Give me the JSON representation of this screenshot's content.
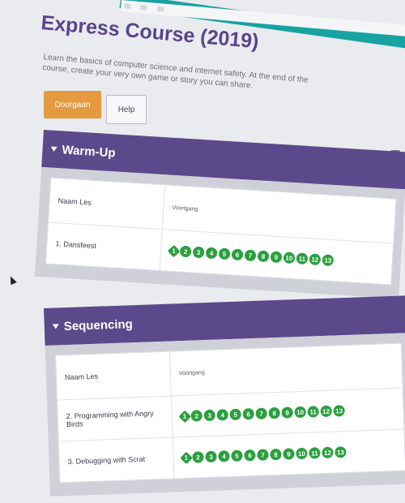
{
  "course": {
    "title": "Express Course (2019)",
    "description": "Learn the basics of computer science and internet safety. At the end of the course, create your very own game or story you can share."
  },
  "actions": {
    "continue_label": "Doorgaan",
    "help_label": "Help"
  },
  "sections": [
    {
      "title": "Warm-Up",
      "col_name": "Naam Les",
      "col_progress": "Voortgang",
      "lessons": [
        {
          "name": "1. Dansfeest",
          "bubbles": [
            "1",
            "2",
            "3",
            "4",
            "5",
            "6",
            "7",
            "8",
            "9",
            "10",
            "11",
            "12",
            "13"
          ]
        }
      ]
    },
    {
      "title": "Sequencing",
      "col_name": "Naam Les",
      "col_progress": "Voortgang",
      "lessons": [
        {
          "name": "2. Programming with Angry Birds",
          "bubbles": [
            "1",
            "2",
            "3",
            "4",
            "5",
            "6",
            "7",
            "8",
            "9",
            "10",
            "11",
            "12",
            "13"
          ]
        },
        {
          "name": "3. Debugging with Scrat",
          "bubbles": [
            "1",
            "2",
            "3",
            "4",
            "5",
            "6",
            "7",
            "8",
            "9",
            "10",
            "11",
            "12",
            "13"
          ]
        }
      ]
    }
  ],
  "colors": {
    "brand_purple": "#5b4a8b",
    "continue_orange": "#e59a3f",
    "progress_green": "#2c9f3f",
    "top_teal": "#18a2a2"
  },
  "icons": {
    "collapse": "caret-down-icon",
    "cursor": "mouse-pointer-icon"
  }
}
